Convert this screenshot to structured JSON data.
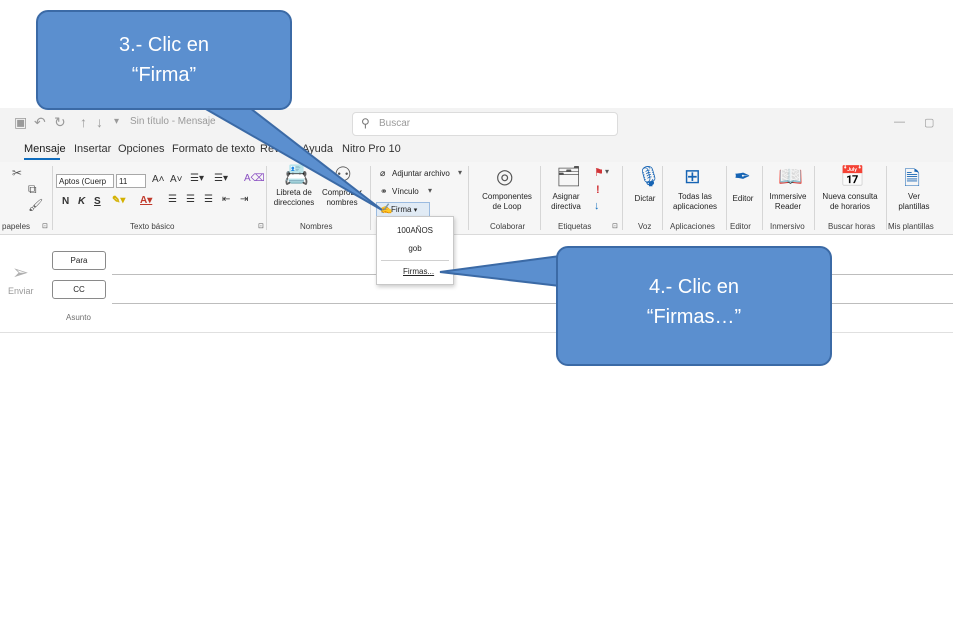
{
  "titlebar": {
    "window_title": "Sin título - Mensaje",
    "search_placeholder": "Buscar"
  },
  "tabs": [
    "Mensaje",
    "Insertar",
    "Opciones",
    "Formato de texto",
    "Revisar",
    "Ayuda",
    "Nitro Pro 10"
  ],
  "ribbon": {
    "font_name": "Aptos (Cuerp",
    "font_size": "11",
    "libreta": "Libreta de\ndirecciones",
    "comprobar": "Comprobar\nnombres",
    "adjuntar": "Adjuntar archivo",
    "vinculo": "Vínculo",
    "firma": "Firma",
    "componentes": "Componentes\nde Loop",
    "asignar": "Asignar\ndirectiva",
    "dictar": "Dictar",
    "todas": "Todas las\naplicaciones",
    "editor": "Editor",
    "immersive": "Immersive\nReader",
    "nueva_consulta": "Nueva consulta\nde horarios",
    "ver_plantillas": "Ver\nplantillas",
    "groups": {
      "papeles": "papeles",
      "texto_basico": "Texto básico",
      "nombres": "Nombres",
      "colaborar": "Colaborar",
      "etiquetas": "Etiquetas",
      "voz": "Voz",
      "aplicaciones": "Aplicaciones",
      "editor": "Editor",
      "inmersivo": "Inmersivo",
      "buscar_horas": "Buscar horas",
      "mis_plantillas": "Mis plantillas"
    }
  },
  "firma_menu": {
    "items": [
      "100AÑOS",
      "gob"
    ],
    "firmas": "Firmas..."
  },
  "composer": {
    "para": "Para",
    "cc": "CC",
    "enviar": "Enviar",
    "asunto": "Asunto"
  },
  "callouts": {
    "step3": "3.- Clic en\n“Firma”",
    "step4": "4.- Clic en\n“Firmas…”"
  },
  "colors": {
    "callout_fill": "#5b8fcf",
    "accent": "#0f6cbd"
  }
}
